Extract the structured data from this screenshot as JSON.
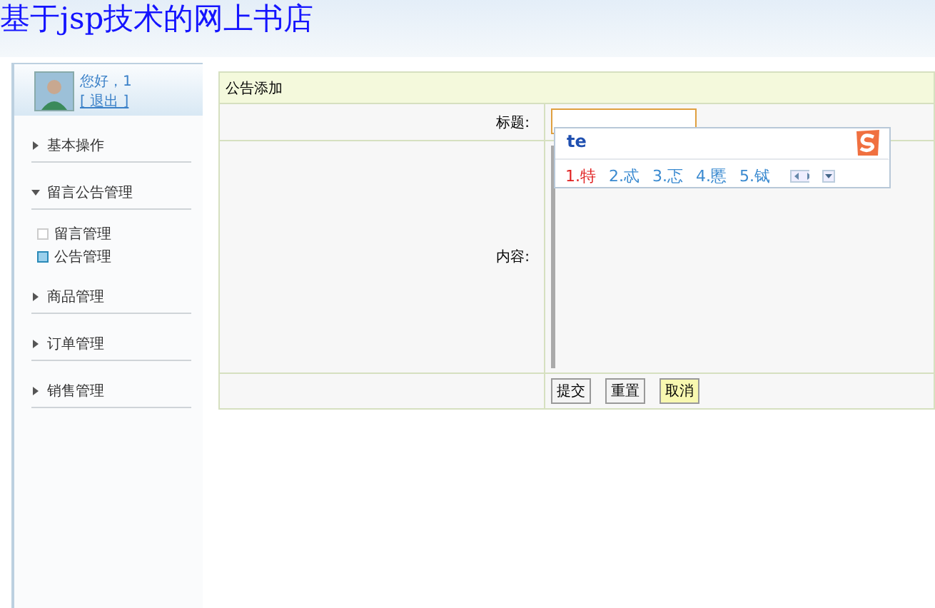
{
  "header": {
    "title": "基于jsp技术的网上书店"
  },
  "sidebar": {
    "greeting": "您好，1",
    "logout": "[ 退出 ]",
    "menu": [
      {
        "label": "基本操作",
        "expanded": false
      },
      {
        "label": "留言公告管理",
        "expanded": true,
        "children": [
          {
            "label": "留言管理",
            "selected": false
          },
          {
            "label": "公告管理",
            "selected": true
          }
        ]
      },
      {
        "label": "商品管理",
        "expanded": false
      },
      {
        "label": "订单管理",
        "expanded": false
      },
      {
        "label": "销售管理",
        "expanded": false
      }
    ]
  },
  "form": {
    "title": "公告添加",
    "fields": [
      {
        "label": "标题:",
        "kind": "input",
        "focused": true
      },
      {
        "label": "内容:",
        "kind": "textarea",
        "focused": false
      }
    ],
    "buttons": [
      {
        "label": "提交",
        "highlighted": false
      },
      {
        "label": "重置",
        "highlighted": false
      },
      {
        "label": "取消",
        "highlighted": true
      }
    ]
  },
  "ime": {
    "input": "te",
    "candidates": [
      {
        "label": "1.特",
        "selected": true
      },
      {
        "label": "2.忒",
        "selected": false
      },
      {
        "label": "3.忑",
        "selected": false
      },
      {
        "label": "4.慝",
        "selected": false
      },
      {
        "label": "5.铽",
        "selected": false
      }
    ]
  }
}
